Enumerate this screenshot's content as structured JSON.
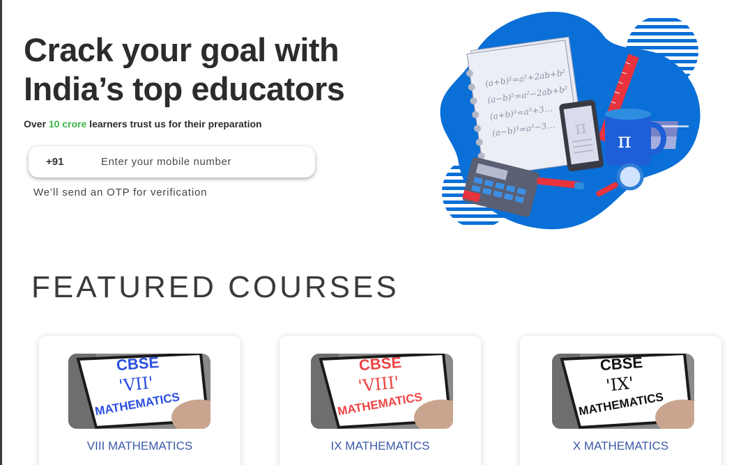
{
  "hero": {
    "title_line1": "Crack your goal with",
    "title_line2": "India’s top educators",
    "subtitle_prefix": "Over ",
    "subtitle_highlight": "10 crore",
    "subtitle_suffix": " learners trust us for their preparation",
    "accent_color": "#3db54a"
  },
  "phone": {
    "prefix": "+91",
    "placeholder": "Enter your mobile number",
    "value": "",
    "note": "We’ll send an OTP for verification"
  },
  "illustration": {
    "formulas": [
      "(a+b)²=a²+2ab+b²",
      "(a−b)²=a²−2ab+b²",
      "(a+b)³=a³+3…",
      "(a−b)³=a³−3…"
    ],
    "pi_symbol": "π",
    "blob_color": "#0a6fd6"
  },
  "featured": {
    "title": "FEATURED COURSES",
    "courses": [
      {
        "name": "VIII MATHEMATICS",
        "thumb_header": "CBSE",
        "thumb_grade": "'VII'",
        "thumb_subject": "MATHEMATICS",
        "thumb_header_color": "#2b4fe0",
        "thumb_text_color": "#2b4fe0"
      },
      {
        "name": "IX MATHEMATICS",
        "thumb_header": "CBSE",
        "thumb_grade": "'VIII'",
        "thumb_subject": "MATHEMATICS",
        "thumb_header_color": "#ee4444",
        "thumb_text_color": "#ee4444"
      },
      {
        "name": "X MATHEMATICS",
        "thumb_header": "CBSE",
        "thumb_grade": "'IX'",
        "thumb_subject": "MATHEMATICS",
        "thumb_header_color": "#111111",
        "thumb_text_color": "#111111"
      }
    ]
  }
}
